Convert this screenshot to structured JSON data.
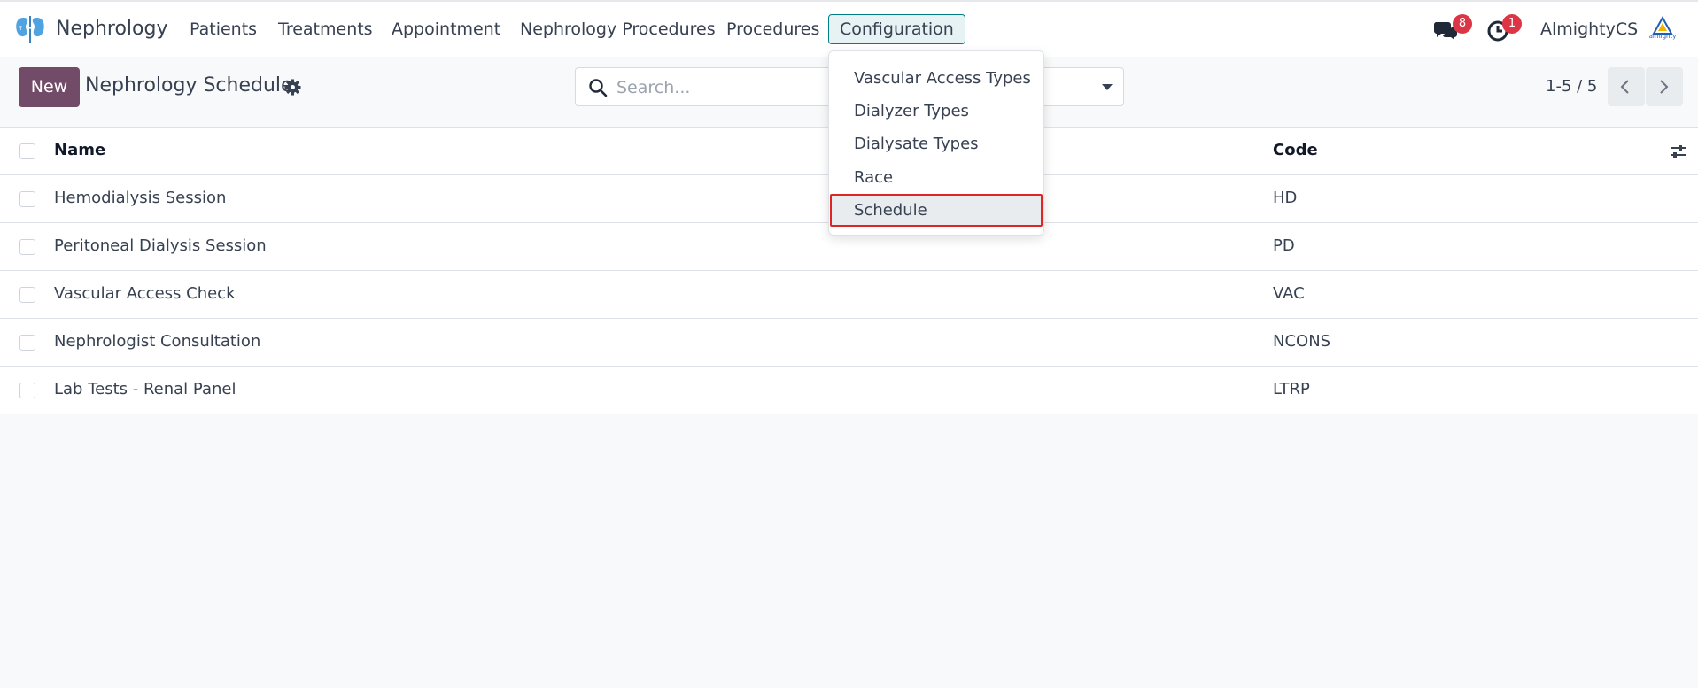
{
  "navbar": {
    "app_name": "Nephrology",
    "menu": [
      {
        "label": "Patients"
      },
      {
        "label": "Treatments"
      },
      {
        "label": "Appointment"
      },
      {
        "label": "Nephrology Procedures"
      },
      {
        "label": "Procedures"
      },
      {
        "label": "Configuration",
        "active": true
      }
    ],
    "messages_count": "8",
    "activities_count": "1",
    "user_name": "AlmightyCS",
    "company_logo_text": "almighty"
  },
  "control_panel": {
    "new_label": "New",
    "breadcrumb": "Nephrology Schedule",
    "search_placeholder": "Search...",
    "pager_value": "1-5 / 5"
  },
  "configuration_menu": {
    "items": [
      {
        "label": "Vascular Access Types"
      },
      {
        "label": "Dialyzer Types"
      },
      {
        "label": "Dialysate Types"
      },
      {
        "label": "Race"
      },
      {
        "label": "Schedule",
        "highlighted": true
      }
    ]
  },
  "list": {
    "columns": {
      "name": "Name",
      "code": "Code"
    },
    "rows": [
      {
        "name": "Hemodialysis Session",
        "code": "HD"
      },
      {
        "name": "Peritoneal Dialysis Session",
        "code": "PD"
      },
      {
        "name": "Vascular Access Check",
        "code": "VAC"
      },
      {
        "name": "Nephrologist Consultation",
        "code": "NCONS"
      },
      {
        "name": "Lab Tests - Renal Panel",
        "code": "LTRP"
      }
    ]
  },
  "colors": {
    "brand": "#714b67",
    "accent": "#017e84",
    "badge": "#dc3545",
    "highlight_border": "#e02424"
  }
}
